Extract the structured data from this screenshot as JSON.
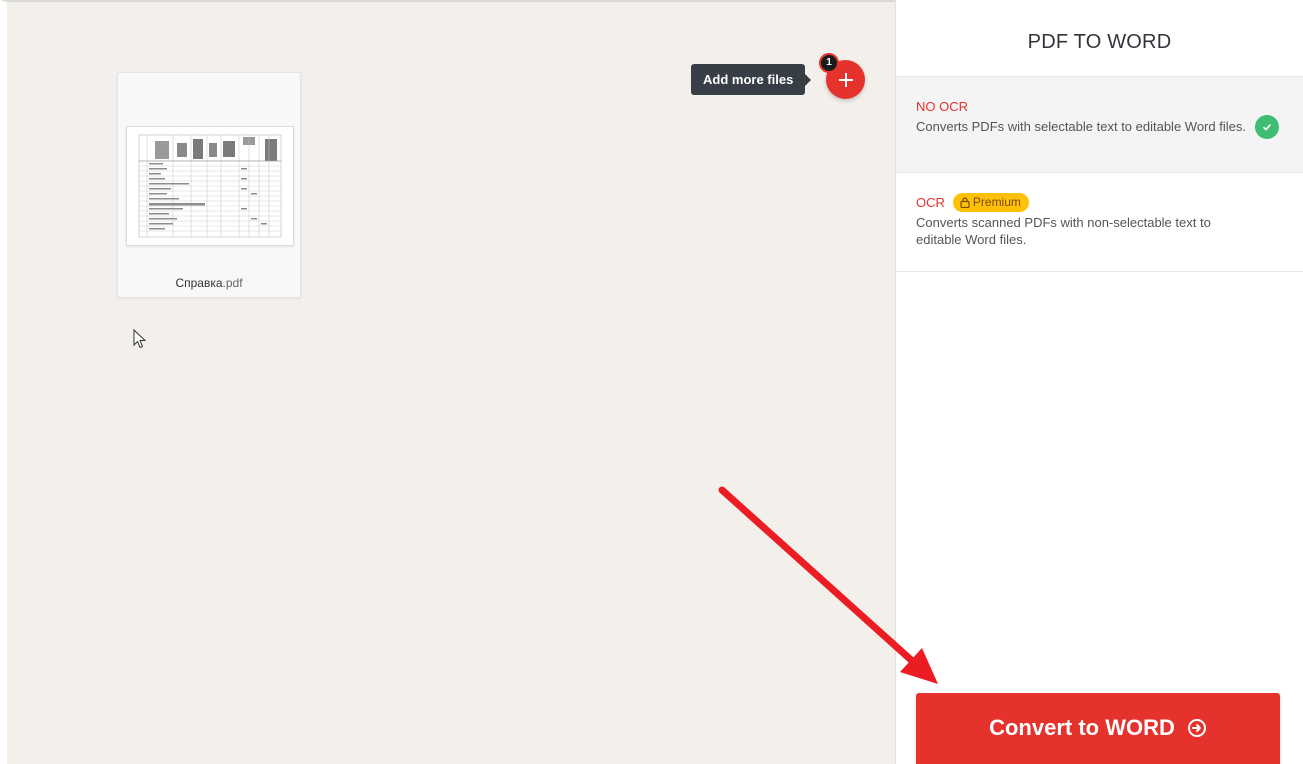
{
  "workspace": {
    "file": {
      "name": "Справка",
      "ext": ".pdf"
    },
    "add_files": {
      "tooltip": "Add more files",
      "count": "1"
    }
  },
  "sidebar": {
    "title": "PDF TO WORD",
    "options": [
      {
        "title": "NO OCR",
        "description": "Converts PDFs with selectable text to editable Word files.",
        "selected": true
      },
      {
        "title": "OCR",
        "badge": "Premium",
        "description": "Converts scanned PDFs with non-selectable text to editable Word files.",
        "selected": false
      }
    ],
    "convert_label": "Convert to WORD"
  },
  "colors": {
    "accent": "#e5322d",
    "premium": "#ffc107",
    "success": "#3fbd73",
    "workspace_bg": "#f3f0ec"
  },
  "icons": {
    "add": "plus-icon",
    "selected": "check-circle-icon",
    "premium": "lock-icon",
    "convert": "arrow-right-circle-icon"
  }
}
